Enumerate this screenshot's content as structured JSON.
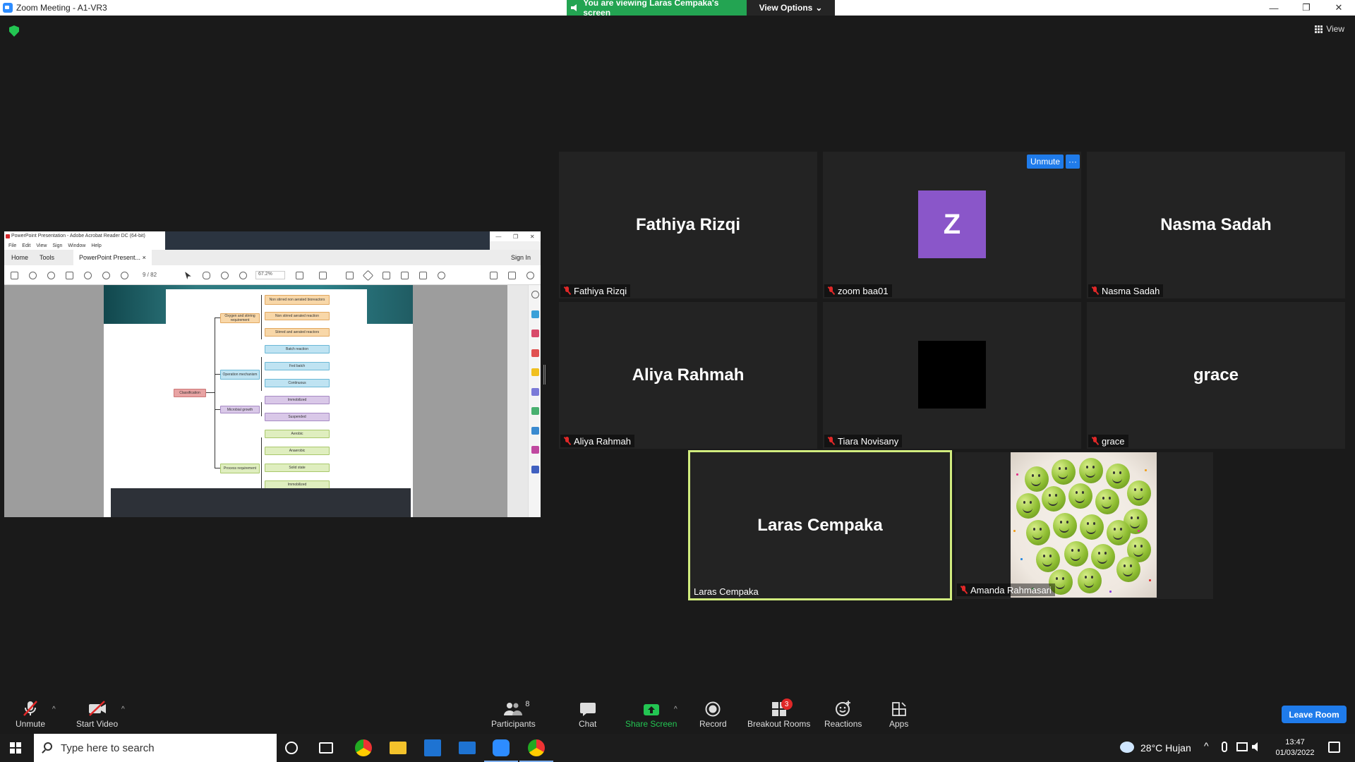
{
  "window": {
    "title": "Zoom Meeting - A1-VR3",
    "controls": [
      "—",
      "❐",
      "✕"
    ]
  },
  "share_banner": {
    "viewing_text": "You are viewing Laras Cempaka's screen",
    "view_options_label": "View Options",
    "view_options_caret": "⌄"
  },
  "view_button": {
    "label": "View"
  },
  "shared_screen": {
    "app_title": "PowerPoint Presentation - Adobe Acrobat Reader DC (64-bit)",
    "window_controls": [
      "—",
      "❐",
      "✕"
    ],
    "menu": [
      "File",
      "Edit",
      "View",
      "Sign",
      "Window",
      "Help"
    ],
    "tabs": {
      "home": "Home",
      "tools": "Tools",
      "document": "PowerPoint Present...",
      "close": "×"
    },
    "sign_in": "Sign In",
    "page_indicator": "9 / 82",
    "zoom": "67.2%",
    "diagram": {
      "root": "Classification",
      "groups": [
        {
          "label": "Oxygen and stirring requirement",
          "items": [
            "Non stirred non aerated bioreactors",
            "Non stirred aerated reaction",
            "Stirred and aerated reactors"
          ]
        },
        {
          "label": "Operation mechanism",
          "items": [
            "Batch reaction",
            "Fed batch",
            "Continuous"
          ]
        },
        {
          "label": "Microbial growth",
          "items": [
            "Immobilized",
            "Suspended"
          ]
        },
        {
          "label": "Process requirement",
          "items": [
            "Aerobic",
            "Anaerobic",
            "Solid state",
            "Immobilized"
          ]
        }
      ]
    }
  },
  "participants_tiles": [
    {
      "big_name": "Fathiya Rizqi",
      "label": "Fathiya Rizqi",
      "kind": "name"
    },
    {
      "big_name": "Z",
      "label": "zoom baa01",
      "kind": "avatar",
      "color": "#8a56c9"
    },
    {
      "big_name": "Nasma Sadah",
      "label": "Nasma Sadah",
      "kind": "name"
    },
    {
      "big_name": "Aliya Rahmah",
      "label": "Aliya Rahmah",
      "kind": "name"
    },
    {
      "big_name": "",
      "label": "Tiara Novisany",
      "kind": "black"
    },
    {
      "big_name": "grace",
      "label": "grace",
      "kind": "name"
    },
    {
      "big_name": "Laras Cempaka",
      "label": "Laras Cempaka",
      "kind": "speaker"
    },
    {
      "big_name": "",
      "label": "Amanda Rahmasari",
      "kind": "photo"
    }
  ],
  "tile_actions": {
    "unmute": "Unmute",
    "more": "···"
  },
  "toolbar": {
    "unmute": "Unmute",
    "start_video": "Start Video",
    "participants": "Participants",
    "participants_count": "8",
    "chat": "Chat",
    "share_screen": "Share Screen",
    "record": "Record",
    "breakout_rooms": "Breakout Rooms",
    "breakout_badge": "3",
    "reactions": "Reactions",
    "apps": "Apps",
    "leave_room": "Leave Room",
    "caret": "^"
  },
  "taskbar": {
    "search_placeholder": "Type here to search",
    "weather": "28°C  Hujan",
    "time": "13:47",
    "date": "01/03/2022"
  },
  "colors": {
    "zoom_blue": "#1f7bea",
    "share_green": "#23a452",
    "speaker_border": "#d1ec7e",
    "muted_red": "#e02828"
  }
}
